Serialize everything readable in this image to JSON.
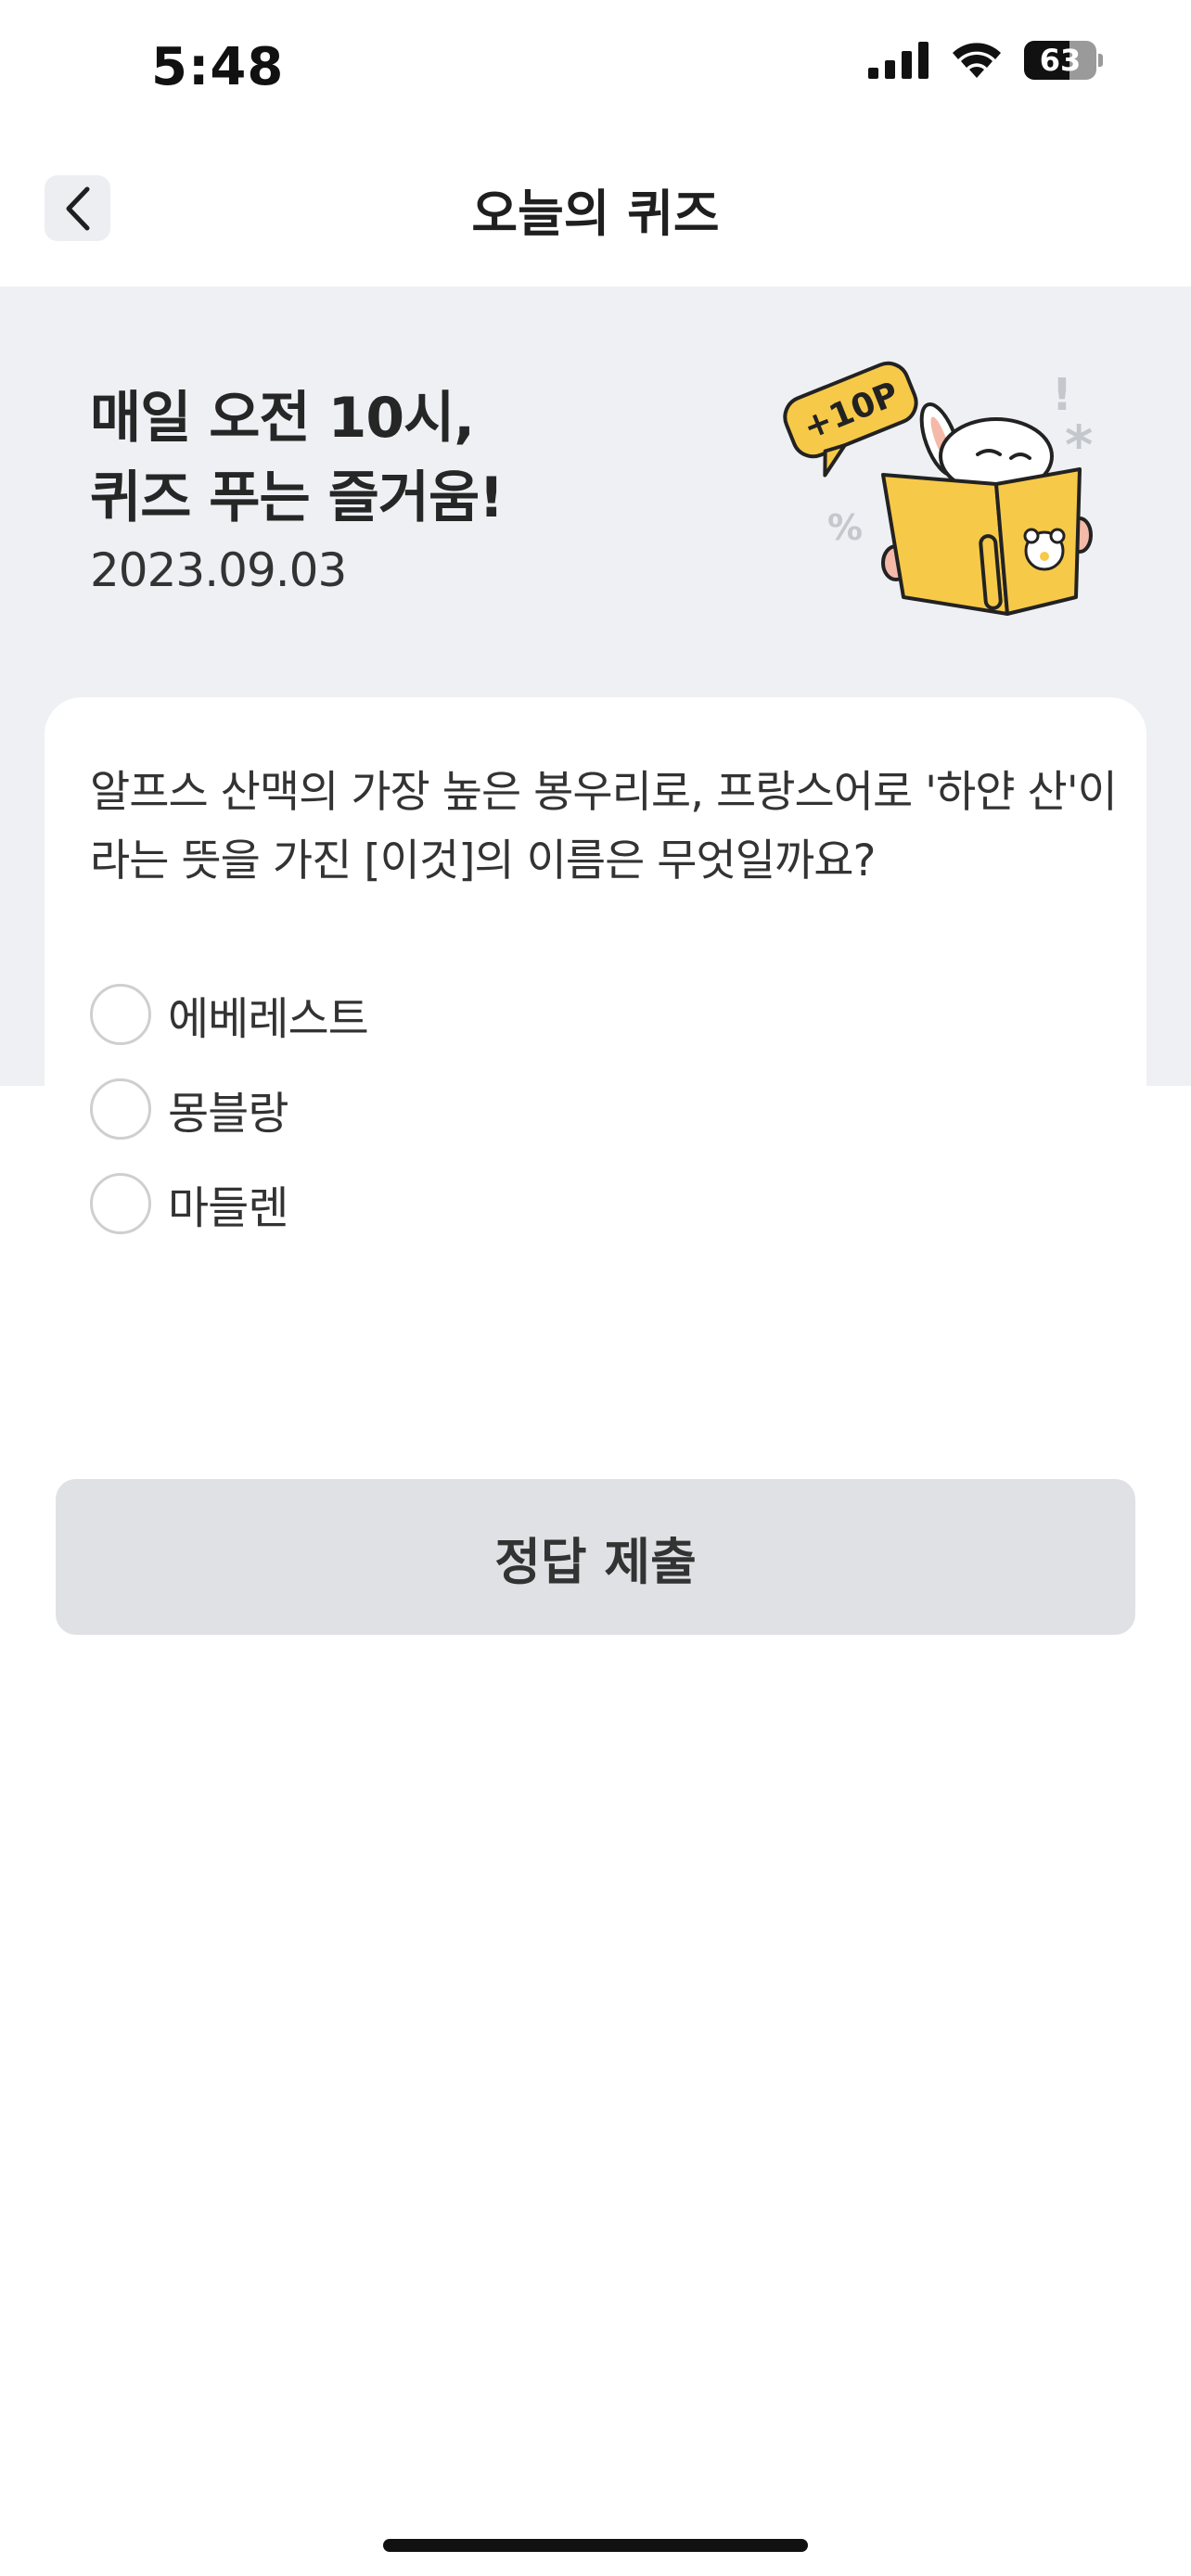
{
  "status_bar": {
    "time": "5:48",
    "battery_level": "63",
    "battery_fraction": 0.63,
    "icons": [
      "signal-icon",
      "wifi-icon",
      "battery-icon"
    ]
  },
  "nav": {
    "back_icon": "chevron-left-icon",
    "title": "오늘의 퀴즈"
  },
  "hero": {
    "title_line1": "매일 오전 10시,",
    "title_line2": "퀴즈 푸는 즐거움!",
    "date": "2023.09.03",
    "badge_text": "+10P"
  },
  "quiz": {
    "question_line1": "알프스 산맥의 가장 높은 봉우리로, 프랑스어로 '하얀 산'이",
    "question_line2": "라는 뜻을 가진 [이것]의 이름은 무엇일까요?",
    "options": [
      {
        "label": "에베레스트",
        "selected": false
      },
      {
        "label": "몽블랑",
        "selected": false
      },
      {
        "label": "마들렌",
        "selected": false
      }
    ],
    "submit_label": "정답 제출"
  },
  "colors": {
    "hero_background": "#eff0f4",
    "book_yellow": "#f7c948",
    "button_disabled": "#dfe1e4"
  }
}
